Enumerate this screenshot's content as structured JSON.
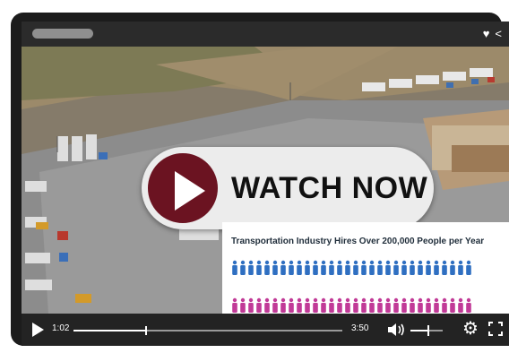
{
  "player": {
    "overlay_label": "WATCH NOW",
    "current_time": "1:02",
    "duration": "3:50",
    "progress_fraction": 0.27,
    "volume_fraction": 0.55
  },
  "infographic": {
    "title": "Transportation Industry Hires Over 200,000 People per Year",
    "blue_icons": "👤👤👤👤👤👤👤👤👤👤👤👤👤👤👤👤👤👤👤👤👤👤👤👤👤👤👤👤👤👤",
    "pink_icons": "👤👤👤👤👤👤👤👤👤👤👤👤👤👤👤👤👤👤👤👤👤👤👤👤👤👤👤👤👤👤"
  },
  "icons": {
    "heart": "♥",
    "share": "<",
    "volume": "🔊",
    "settings": "⚙",
    "fullscreen": "⤧"
  },
  "colors": {
    "play_circle": "#6b1321",
    "blue_people": "#2f6fc1",
    "pink_people": "#c13a97"
  }
}
